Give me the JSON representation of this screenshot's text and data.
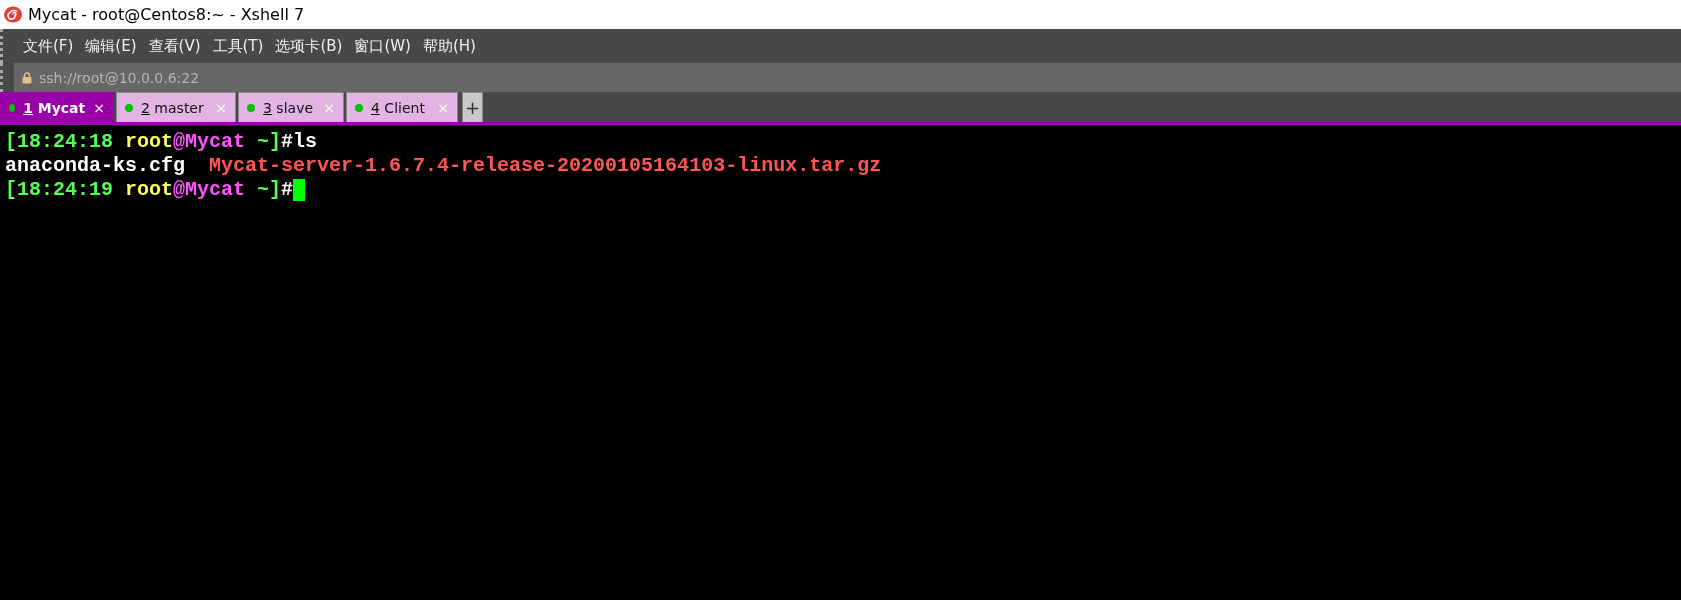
{
  "window": {
    "title": "Mycat - root@Centos8:~ - Xshell 7"
  },
  "menu": [
    "文件(F)",
    "编辑(E)",
    "查看(V)",
    "工具(T)",
    "选项卡(B)",
    "窗口(W)",
    "帮助(H)"
  ],
  "address": {
    "value": "ssh://root@10.0.0.6:22"
  },
  "tabs": [
    {
      "number": "1",
      "label": "Mycat",
      "selected": true,
      "color": "#00c000",
      "close": "×"
    },
    {
      "number": "2",
      "label": "master",
      "selected": false,
      "color": "#00c000",
      "close": "×"
    },
    {
      "number": "3",
      "label": "slave",
      "selected": false,
      "color": "#00c000",
      "close": "×"
    },
    {
      "number": "4",
      "label": "Client",
      "selected": false,
      "color": "#00c000",
      "close": "×"
    }
  ],
  "new_tab": "+",
  "terminal": {
    "lines": [
      {
        "segments": [
          {
            "text": "[18:24:18 ",
            "color": "#55ff55"
          },
          {
            "text": "root",
            "color": "#ffff55"
          },
          {
            "text": "@Mycat",
            "color": "#ff55ff"
          },
          {
            "text": " ~]",
            "color": "#55ff55"
          },
          {
            "text": "#ls",
            "color": "#ffffff"
          }
        ],
        "cursor": false
      },
      {
        "segments": [
          {
            "text": "anaconda-ks.cfg  ",
            "color": "#ffffff"
          },
          {
            "text": "Mycat-server-1.6.7.4-release-20200105164103-linux.tar.gz",
            "color": "#ff5555"
          }
        ],
        "cursor": false
      },
      {
        "segments": [
          {
            "text": "[18:24:19 ",
            "color": "#55ff55"
          },
          {
            "text": "root",
            "color": "#ffff55"
          },
          {
            "text": "@Mycat",
            "color": "#ff55ff"
          },
          {
            "text": " ~]",
            "color": "#55ff55"
          },
          {
            "text": "#",
            "color": "#ffffff"
          }
        ],
        "cursor": true
      }
    ]
  }
}
